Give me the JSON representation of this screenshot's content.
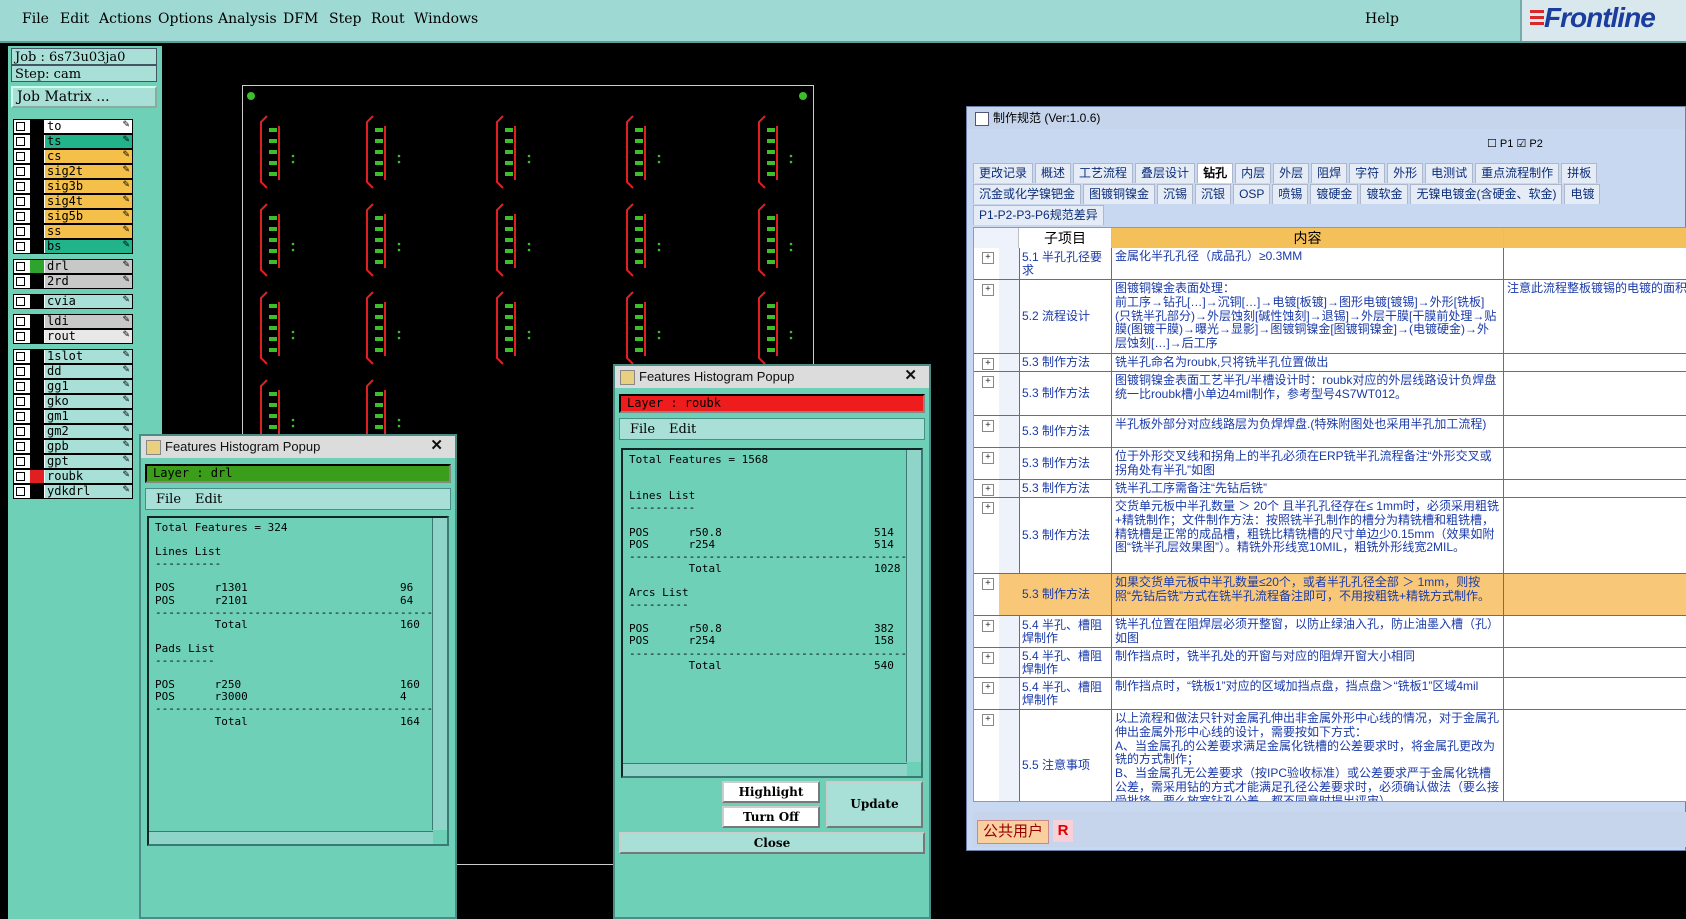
{
  "menubar": {
    "items": [
      "File",
      "Edit",
      "Actions",
      "Options",
      "Analysis",
      "DFM",
      "Step",
      "Rout",
      "Windows"
    ],
    "help": "Help",
    "logo": "Frontline"
  },
  "leftpanel": {
    "job": "Job : 6s73u03ja0",
    "step": "Step: cam",
    "job_matrix": "Job Matrix ...",
    "layers": [
      {
        "name": "to",
        "color": "#ffffff",
        "sw": "#000000"
      },
      {
        "name": "ts",
        "color": "#21b38a",
        "sw": "#000000"
      },
      {
        "name": "cs",
        "color": "#f4c04a",
        "sw": "#000000"
      },
      {
        "name": "sig2t",
        "color": "#f4c04a",
        "sw": "#000000"
      },
      {
        "name": "sig3b",
        "color": "#f4c04a",
        "sw": "#000000"
      },
      {
        "name": "sig4t",
        "color": "#f4c04a",
        "sw": "#000000"
      },
      {
        "name": "sig5b",
        "color": "#f4c04a",
        "sw": "#000000"
      },
      {
        "name": "ss",
        "color": "#f4c04a",
        "sw": "#000000"
      },
      {
        "name": "bs",
        "color": "#21b38a",
        "sw": "#000000"
      },
      {
        "name": "drl",
        "color": "#c8c8c8",
        "sw": "#2ea42e"
      },
      {
        "name": "2rd",
        "color": "#c8c8c8",
        "sw": "#000000"
      },
      {
        "name": "cvia",
        "color": "#a8e0d8",
        "sw": "#000000"
      },
      {
        "name": "ldi",
        "color": "#c8c8c8",
        "sw": "#000000"
      },
      {
        "name": "rout",
        "color": "#e8e8e8",
        "sw": "#000000"
      },
      {
        "name": "1slot",
        "color": "#a8e0d8",
        "sw": "#000000"
      },
      {
        "name": "dd",
        "color": "#a8e0d8",
        "sw": "#000000"
      },
      {
        "name": "gg1",
        "color": "#a8e0d8",
        "sw": "#000000"
      },
      {
        "name": "gko",
        "color": "#a8e0d8",
        "sw": "#000000"
      },
      {
        "name": "gm1",
        "color": "#a8e0d8",
        "sw": "#000000"
      },
      {
        "name": "gm2",
        "color": "#a8e0d8",
        "sw": "#000000"
      },
      {
        "name": "gpb",
        "color": "#a8e0d8",
        "sw": "#000000"
      },
      {
        "name": "gpt",
        "color": "#a8e0d8",
        "sw": "#000000"
      },
      {
        "name": "roubk",
        "color": "#a8e0d8",
        "sw": "#e02020"
      },
      {
        "name": "ydkdrl",
        "color": "#a8e0d8",
        "sw": "#000000"
      }
    ]
  },
  "popup1": {
    "title": "Features Histogram Popup",
    "layer": "Layer :  drl",
    "menu_file": "File",
    "menu_edit": "Edit",
    "text": "Total Features = 324\n\nLines List\n----------\n\nPOS      r1301                       96\nPOS      r2101                       64\n--------------------------------------------\n         Total                       160\n\nPads List\n---------\n\nPOS      r250                        160\nPOS      r3000                       4\n--------------------------------------------\n         Total                       164"
  },
  "popup2": {
    "title": "Features Histogram Popup",
    "layer": "Layer :  roubk",
    "menu_file": "File",
    "menu_edit": "Edit",
    "text": "Total Features = 1568\n\n\nLines List\n----------\n\nPOS      r50.8                       514\nPOS      r254                        514\n--------------------------------------------\n         Total                       1028\n\nArcs List\n---------\n\nPOS      r50.8                       382\nPOS      r254                        158\n--------------------------------------------\n         Total                       540",
    "highlight": "Highlight",
    "turn_off": "Turn Off",
    "update": "Update",
    "close": "Close"
  },
  "spec": {
    "title": "制作规范 (Ver:1.0.6)",
    "p_checks": [
      "P1",
      "P2"
    ],
    "tabs1": [
      "更改记录",
      "概述",
      "工艺流程",
      "叠层设计",
      "钻孔",
      "内层",
      "外层",
      "阻焊",
      "字符",
      "外形",
      "电测试",
      "重点流程制作",
      "拼板"
    ],
    "tabs2": [
      "沉金或化学镍钯金",
      "图镀铜镍金",
      "沉锡",
      "沉银",
      "OSP",
      "喷锡",
      "镀硬金",
      "镀软金",
      "无镍电镀金(含硬金、软金)",
      "电镀"
    ],
    "tabs3": [
      "P1-P2-P3-P6规范差异"
    ],
    "selected_tab": "钻孔",
    "col1": "子项目",
    "col2": "内容",
    "rows": [
      {
        "h": 32,
        "a": "5.1 半孔孔径要求",
        "b": "金属化半孔孔径（成品孔）≥0.3MM",
        "c": ""
      },
      {
        "h": 74,
        "a": "5.2 流程设计",
        "b": "图镀铜镍金表面处理：\n前工序→钻孔[…]→沉铜[…]→电镀[板镀]→图形电镀[镀锡]→外形[铣板](只铣半孔部分)→外层蚀刻[碱性蚀刻]→退锡]→外层干膜[干膜前处理→贴膜(图镀干膜)→曝光→显影]→图镀铜镍金[图镀铜镍金]→(电镀硬金)→外层蚀刻[…]→后工序",
        "c": "注意此流程整板镀锡的电镀的面积"
      },
      {
        "h": 18,
        "a": "5.3 制作方法",
        "b": "铣半孔命名为roubk,只将铣半孔位置做出",
        "c": ""
      },
      {
        "h": 44,
        "a": "5.3 制作方法",
        "b": "图镀铜镍金表面工艺半孔/半槽设计时：roubk对应的外层线路设计负焊盘统一比roubk槽小单边4mil制作，参考型号4S7WT012。",
        "c": ""
      },
      {
        "h": 32,
        "a": "5.3 制作方法",
        "b": "半孔板外部分对应线路层为负焊焊盘.(特殊附图处也采用半孔加工流程)",
        "c": ""
      },
      {
        "h": 32,
        "a": "5.3 制作方法",
        "b": "位于外形交叉线和拐角上的半孔必须在ERP铣半孔流程备注“外形交叉或拐角处有半孔”如图",
        "c": ""
      },
      {
        "h": 18,
        "a": "5.3 制作方法",
        "b": "铣半孔工序需备注“先钻后铣”",
        "c": ""
      },
      {
        "h": 76,
        "a": "5.3 制作方法",
        "b": "交货单元板中半孔数量 ＞ 20个 且半孔孔径存在≤ 1mm时，必须采用粗铣+精铣制作；文件制作方法：按照铣半孔制作的槽分为精铣槽和粗铣槽，精铣槽是正常的成品槽，粗铣比精铣槽的尺寸单边少0.15mm（效果如附图“铣半孔层效果图”）。精铣外形线宽10MIL，粗铣外形线宽2MIL。",
        "c": "",
        "hl": false
      },
      {
        "h": 42,
        "a": "5.3 制作方法",
        "b": "如果交货单元板中半孔数量≤20个，或者半孔孔径全部 ＞ 1mm，则按照“先钻后铣”方式在铣半孔流程备注即可，不用按粗铣+精铣方式制作。",
        "c": "",
        "hl": true
      },
      {
        "h": 32,
        "a": "5.4 半孔、槽阻焊制作",
        "b": "铣半孔位置在阻焊层必须开整窗，以防止绿油入孔，防止油墨入槽（孔）  如图",
        "c": ""
      },
      {
        "h": 30,
        "a": "5.4 半孔、槽阻焊制作",
        "b": "制作挡点时，铣半孔处的开窗与对应的阻焊开窗大小相同",
        "c": ""
      },
      {
        "h": 32,
        "a": "5.4 半孔、槽阻焊制作",
        "b": "制作挡点时，“铣板1”对应的区域加挡点盘，挡点盘＞“铣板1”区域4mil",
        "c": ""
      },
      {
        "h": 112,
        "a": "5.5 注意事项",
        "b": "以上流程和做法只针对金属孔伸出非金属外形中心线的情况，对于金属孔伸出金属外形中心线的设计，需要按如下方式：\nA、当金属孔的公差要求满足金属化铣槽的公差要求时，将金属孔更改为铣的方式制作；\nB、当金属孔无公差要求（按IPC验收标准）或公差要求严于金属化铣槽公差，需采用钻的方式才能满足孔径公差要求时，必须确认做法（要么接受批锋，要么放宽钻孔公差，都不同意时提出评审）",
        "c": ""
      }
    ],
    "user": "公共用户",
    "user_badge": "R"
  }
}
